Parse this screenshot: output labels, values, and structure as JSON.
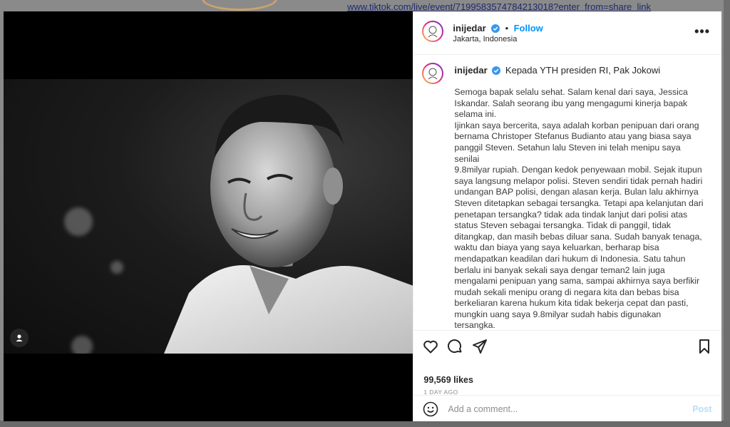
{
  "background": {
    "url_text": "www.tiktok.com/live/event/7199583574784213018?enter_from=share_link"
  },
  "post": {
    "username": "inijedar",
    "follow_label": "Follow",
    "location": "Jakarta, Indonesia",
    "more_label": "•••",
    "caption_title": "Kepada YTH presiden RI, Pak Jokowi",
    "caption_body": "Semoga bapak selalu sehat. Salam kenal dari saya, Jessica\nIskandar. Salah seorang ibu yang mengagumi kinerja bapak\nselama ini.\nIjinkan saya bercerita, saya adalah korban penipuan dari orang\nbernama Christoper Stefanus Budianto atau yang biasa saya\npanggil Steven. Setahun lalu Steven ini telah menipu saya senilai\n9.8milyar rupiah. Dengan kedok penyewaan mobil. Sejak itupun\nsaya langsung melapor polisi. Steven sendiri tidak pernah hadiri\nundangan BAP polisi, dengan alasan kerja. Bulan lalu akhirnya\nSteven ditetapkan sebagai tersangka. Tetapi apa kelanjutan dari\npenetapan tersangka? tidak ada tindak lanjut dari polisi atas\nstatus Steven sebagai tersangka. Tidak di panggil, tidak\nditangkap, dan masih bebas diluar sana. Sudah banyak tenaga,\nwaktu dan biaya yang saya keluarkan, berharap bisa\nmendapatkan keadilan dari hukum di Indonesia. Satu tahun\nberlalu ini banyak sekali saya dengar teman2 lain juga\nmengalami penipuan yang sama, sampai akhirnya saya berfikir\nmudah sekali menipu orang di negara kita dan bebas bisa\nberkeliaran karena hukum kita tidak bekerja cepat dan pasti,\nmungkin uang saya 9.8milyar sudah habis digunakan tersangka.\nAkhirnya apa yang saya dapat? Pelajaran bahwa menipu lebih\nmudah dari kerja keras. Harapan saya, Pak Jokowi bisa",
    "likes": "99,569 likes",
    "date": "1 DAY AGO",
    "comment_placeholder": "Add a comment...",
    "post_label": "Post"
  },
  "icons": {
    "verified": "verified-badge-icon",
    "like": "heart-icon",
    "comment": "comment-icon",
    "share": "paper-plane-icon",
    "save": "bookmark-icon",
    "emoji": "emoji-icon",
    "tag": "user-tag-icon"
  },
  "colors": {
    "link": "#0095f6",
    "verified": "#3897f0",
    "post_disabled": "#b2dffc"
  }
}
